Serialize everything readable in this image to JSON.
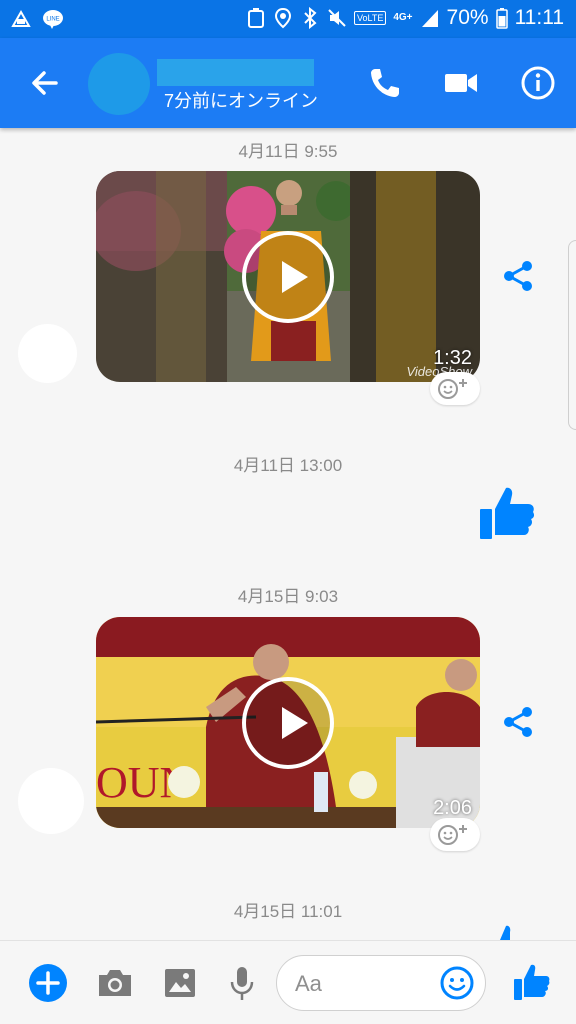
{
  "status_bar": {
    "time": "11:11",
    "battery": "70%",
    "network": "4G+",
    "volte": "VoLTE",
    "line_badge": "LINE"
  },
  "header": {
    "presence": "7分前にオンライン",
    "icons": [
      "back-arrow-icon",
      "phone-icon",
      "video-camera-icon",
      "info-icon"
    ]
  },
  "messages": [
    {
      "type": "timestamp",
      "text": "4月11日 9:55"
    },
    {
      "type": "video",
      "duration": "1:32",
      "watermark": "VideoShow"
    },
    {
      "type": "timestamp",
      "text": "4月11日 13:00"
    },
    {
      "type": "like",
      "icon": "thumbs-up-icon"
    },
    {
      "type": "timestamp",
      "text": "4月15日 9:03"
    },
    {
      "type": "video",
      "duration": "2:06"
    },
    {
      "type": "timestamp",
      "text": "4月15日 11:01"
    }
  ],
  "composer": {
    "placeholder": "Aa",
    "icons": [
      "plus-icon",
      "camera-icon",
      "gallery-icon",
      "microphone-icon",
      "emoji-icon",
      "thumbs-up-icon"
    ]
  },
  "colors": {
    "accent": "#0084ff",
    "header": "#1c7cf4",
    "status_bar": "#0a74e6"
  }
}
